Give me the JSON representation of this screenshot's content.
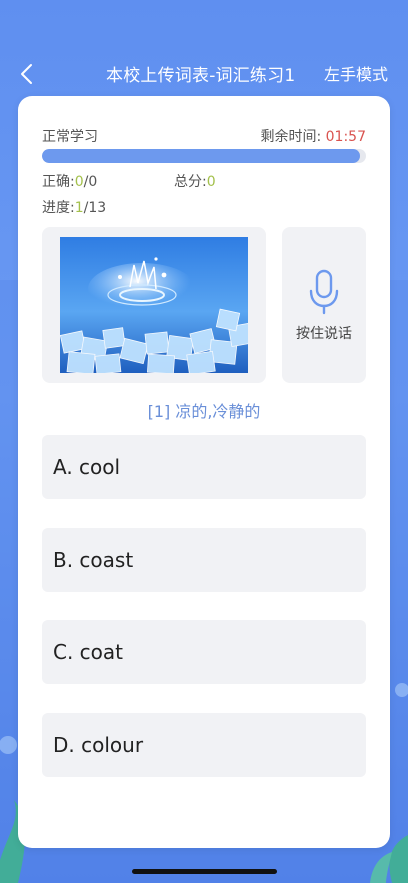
{
  "header": {
    "title": "本校上传词表-词汇练习1",
    "mode_label": "左手模式"
  },
  "status": {
    "mode": "正常学习",
    "time_label": "剩余时间:",
    "time_value": "01:57",
    "progress_fraction": 0.98
  },
  "stats": {
    "correct_label": "正确:",
    "correct_value": "0",
    "correct_total": "/0",
    "score_label": "总分:",
    "score_value": "0",
    "progress_label": "进度:",
    "progress_current": "1",
    "progress_total": "/13"
  },
  "voice": {
    "label": "按住说话"
  },
  "question": {
    "text": "[1] 凉的,冷静的"
  },
  "options": [
    {
      "label": "A. cool"
    },
    {
      "label": "B. coast"
    },
    {
      "label": "C. coat"
    },
    {
      "label": "D. colour"
    }
  ],
  "colors": {
    "accent": "#6d99ee",
    "timer": "#d9534f",
    "highlight": "#a3c04b"
  }
}
